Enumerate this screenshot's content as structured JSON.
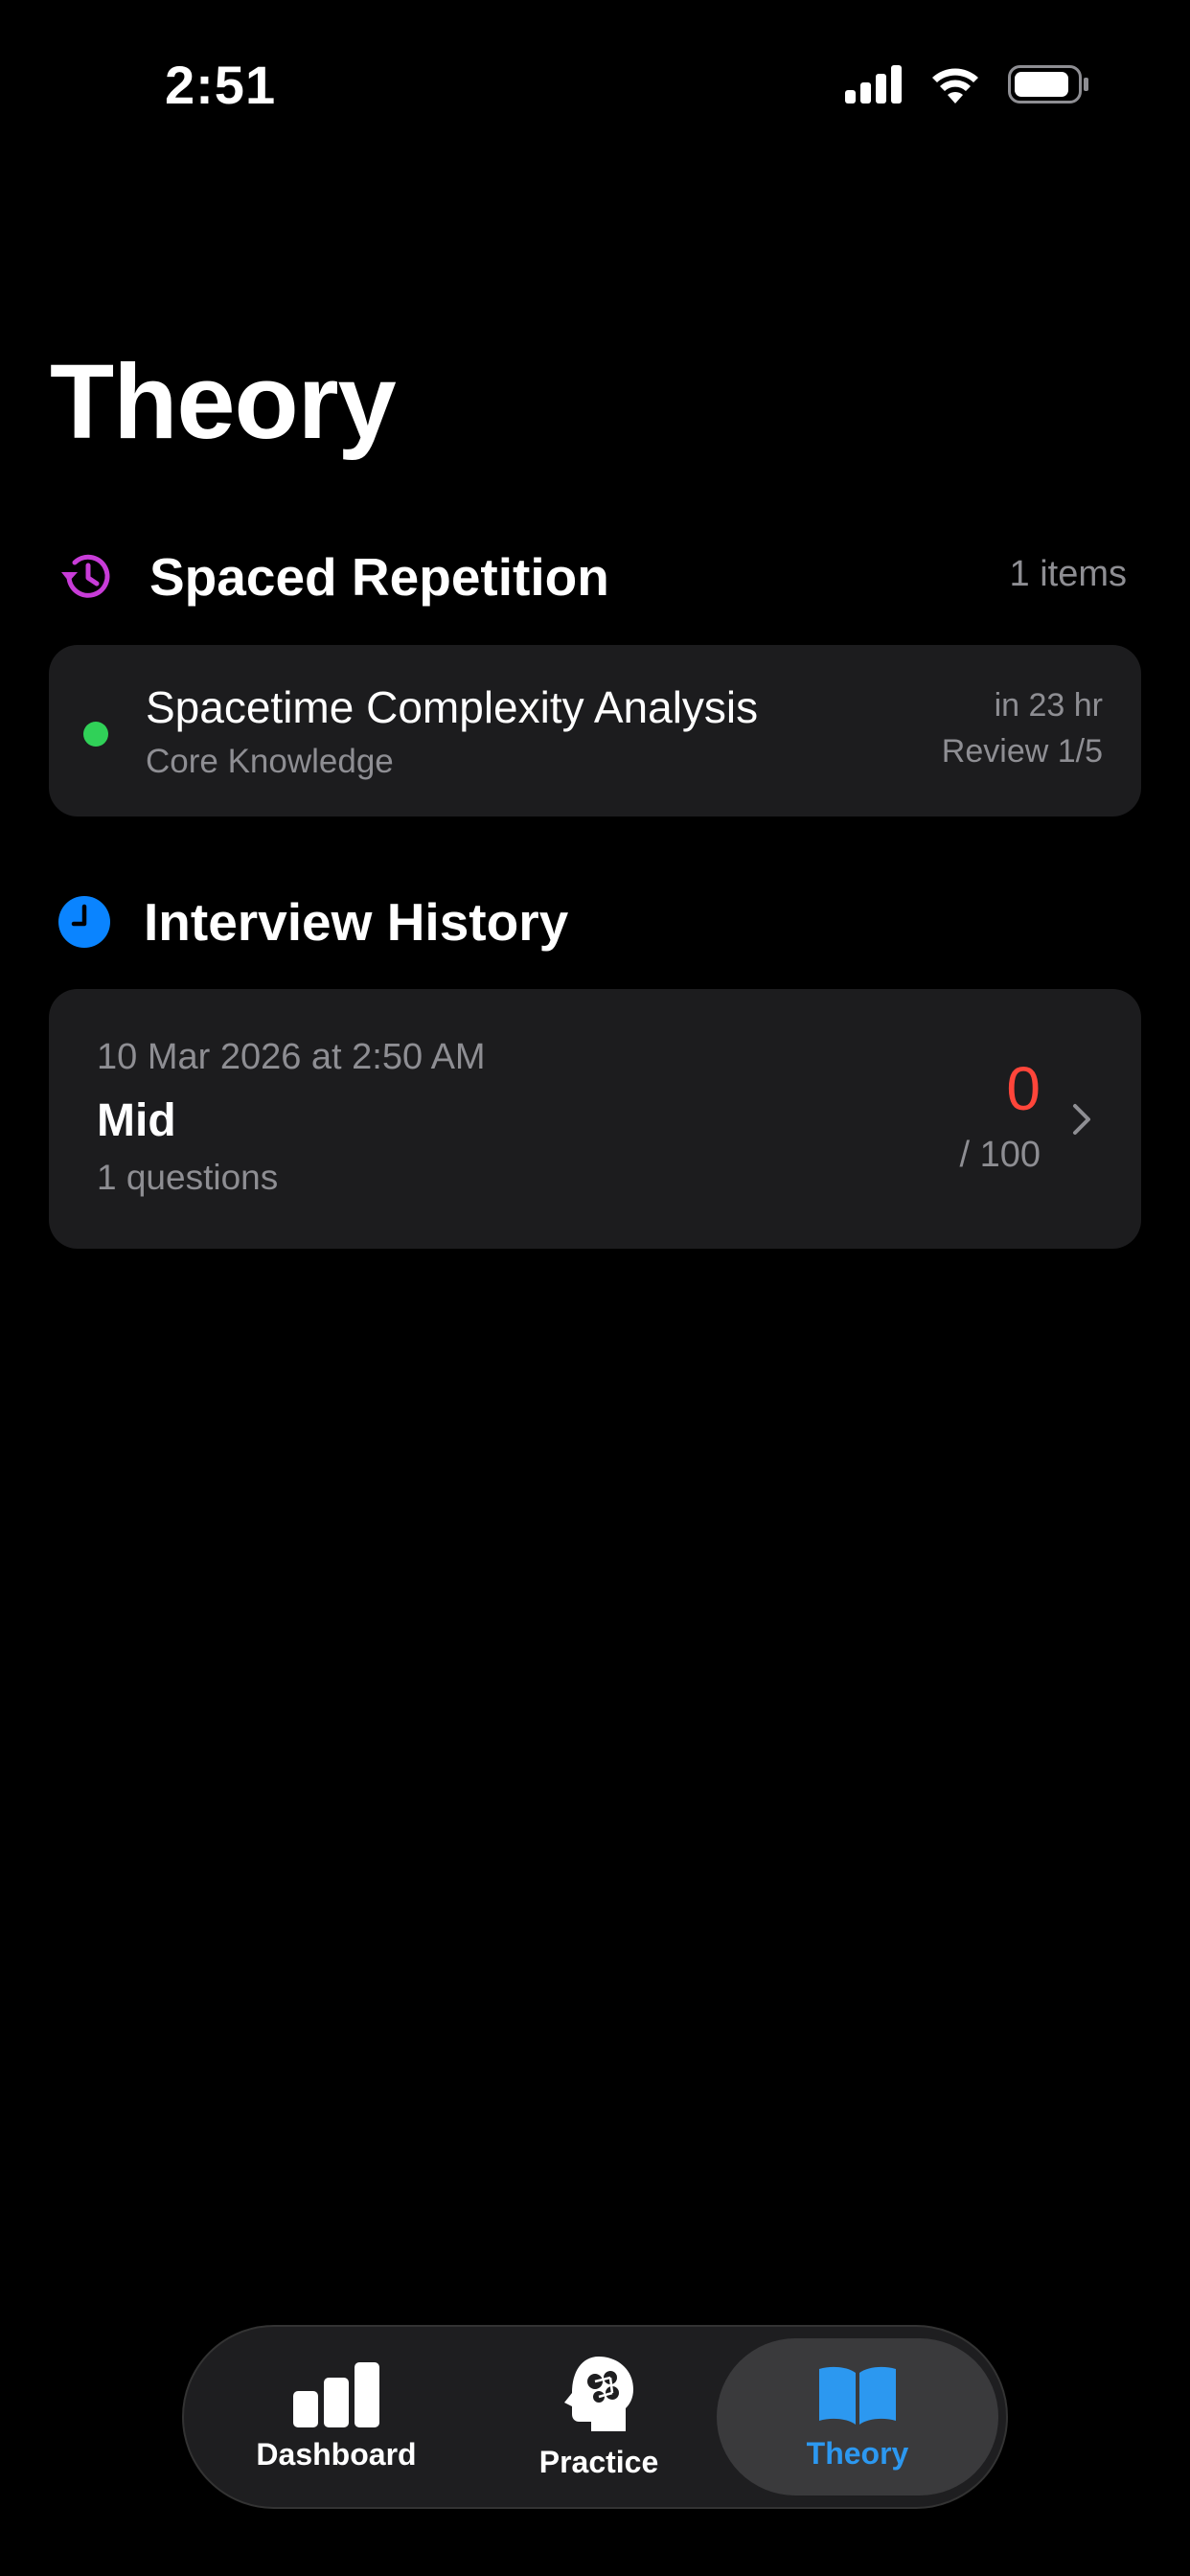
{
  "status_bar": {
    "time": "2:51"
  },
  "page": {
    "title": "Theory"
  },
  "spaced_repetition": {
    "title": "Spaced Repetition",
    "count_label": "1 items",
    "icon": "history-icon",
    "accent_color": "#c83cd8",
    "items": [
      {
        "title": "Spacetime Complexity Analysis",
        "subtitle": "Core Knowledge",
        "due": "in 23 hr",
        "review": "Review 1/5",
        "status_color": "#30d158"
      }
    ]
  },
  "interview_history": {
    "title": "Interview History",
    "icon": "clock-icon",
    "accent_color": "#0a84ff",
    "items": [
      {
        "date": "10 Mar 2026 at 2:50 AM",
        "level": "Mid",
        "questions": "1 questions",
        "score": "0",
        "total": "/ 100",
        "score_color": "#ff453a"
      }
    ]
  },
  "tab_bar": {
    "active": "Theory",
    "active_color": "#2c98f0",
    "tabs": [
      {
        "label": "Dashboard",
        "icon": "bar-chart-icon"
      },
      {
        "label": "Practice",
        "icon": "brain-head-icon"
      },
      {
        "label": "Theory",
        "icon": "book-icon"
      }
    ]
  }
}
